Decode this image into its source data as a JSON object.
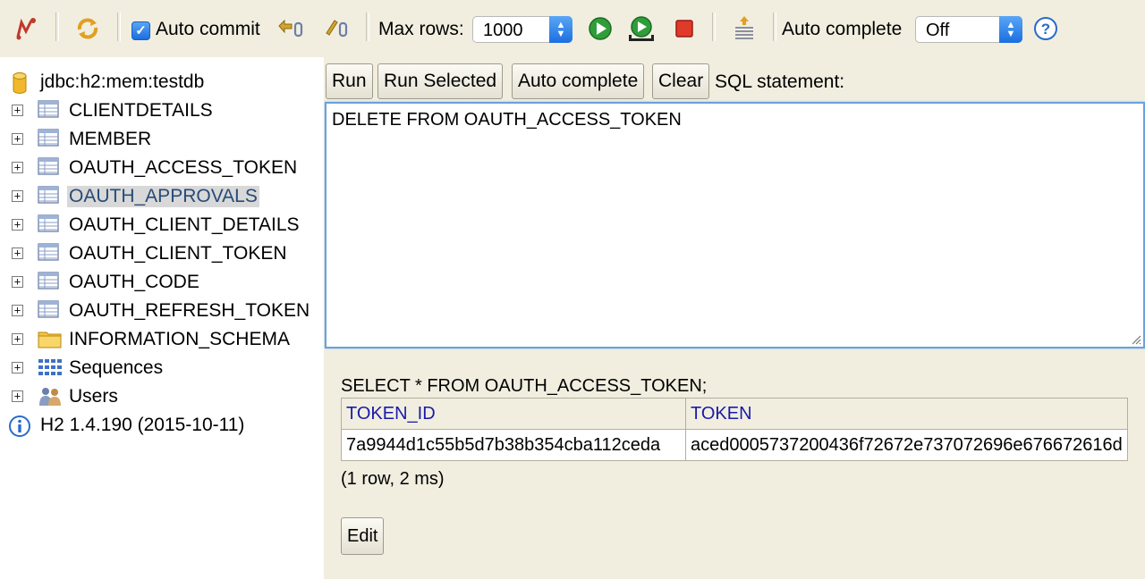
{
  "toolbar": {
    "auto_commit_label": "Auto commit",
    "auto_commit_checked": true,
    "max_rows_label": "Max rows:",
    "max_rows_value": "1000",
    "auto_complete_label": "Auto complete",
    "auto_complete_value": "Off",
    "icons": [
      "disconnect-icon",
      "refresh-icon",
      "rollback-icon",
      "commit-icon",
      "run-icon",
      "run-selected-icon",
      "stop-icon",
      "history-icon",
      "help-icon"
    ]
  },
  "tree": {
    "connection": "jdbc:h2:mem:testdb",
    "items": [
      {
        "label": "CLIENTDETAILS",
        "type": "table"
      },
      {
        "label": "MEMBER",
        "type": "table"
      },
      {
        "label": "OAUTH_ACCESS_TOKEN",
        "type": "table"
      },
      {
        "label": "OAUTH_APPROVALS",
        "type": "table",
        "selected": true
      },
      {
        "label": "OAUTH_CLIENT_DETAILS",
        "type": "table"
      },
      {
        "label": "OAUTH_CLIENT_TOKEN",
        "type": "table"
      },
      {
        "label": "OAUTH_CODE",
        "type": "table"
      },
      {
        "label": "OAUTH_REFRESH_TOKEN",
        "type": "table"
      },
      {
        "label": "INFORMATION_SCHEMA",
        "type": "folder"
      },
      {
        "label": "Sequences",
        "type": "sequences"
      },
      {
        "label": "Users",
        "type": "users"
      }
    ],
    "version": "H2 1.4.190 (2015-10-11)"
  },
  "query": {
    "buttons": {
      "run": "Run",
      "run_selected": "Run Selected",
      "auto_complete": "Auto complete",
      "clear": "Clear"
    },
    "sql_label": "SQL statement:",
    "sql_text": "DELETE FROM OAUTH_ACCESS_TOKEN"
  },
  "results": {
    "statement": "SELECT * FROM OAUTH_ACCESS_TOKEN;",
    "columns": [
      "TOKEN_ID",
      "TOKEN"
    ],
    "rows": [
      [
        "7a9944d1c55b5d7b38b354cba112ceda",
        "aced0005737200436f72672e737072696e676672616d"
      ]
    ],
    "summary": "(1 row, 2 ms)",
    "edit_label": "Edit"
  },
  "colors": {
    "panel_bg": "#f1eee0",
    "header_text": "#1a1aa8",
    "selection_bg": "#d8d8d8",
    "accent": "#1b6fe0"
  }
}
